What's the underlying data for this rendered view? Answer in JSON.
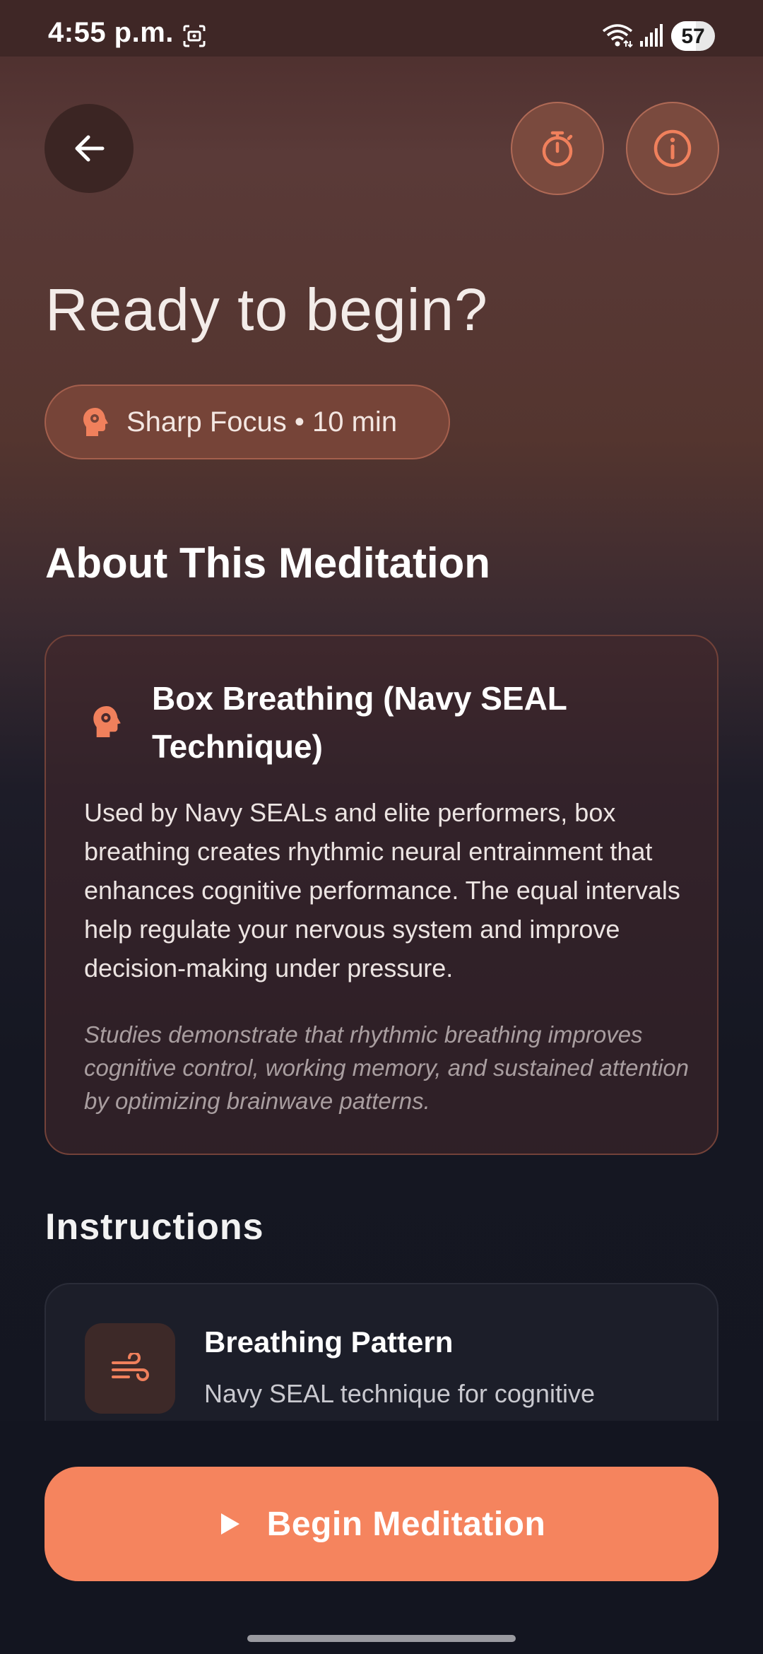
{
  "status_bar": {
    "time": "4:55 p.m.",
    "battery": "57",
    "battery_fraction": 0.57
  },
  "header": {
    "back_icon": "arrow-left-icon",
    "timer_icon": "stopwatch-icon",
    "info_icon": "info-icon"
  },
  "title": "Ready to begin?",
  "session_chip": {
    "icon": "head-gear-icon",
    "label": "Sharp Focus • 10 min"
  },
  "about": {
    "heading": "About This Meditation",
    "card_title": "Box Breathing (Navy SEAL Technique)",
    "body": "Used by Navy SEALs and elite performers, box breathing creates rhythmic neural entrainment that enhances cognitive performance. The equal intervals help regulate your nervous system and improve decision-making under pressure.",
    "note": "Studies demonstrate that rhythmic breathing improves cognitive control, working memory, and sustained attention by optimizing brainwave patterns."
  },
  "instructions": {
    "heading": "Instructions",
    "items": [
      {
        "icon": "wind-icon",
        "title": "Breathing Pattern",
        "subtitle": "Navy SEAL technique for cognitive"
      }
    ]
  },
  "cta": {
    "label": "Begin Meditation",
    "icon": "play-icon"
  },
  "colors": {
    "accent": "#F5845E",
    "icon_accent": "#F0805C"
  }
}
